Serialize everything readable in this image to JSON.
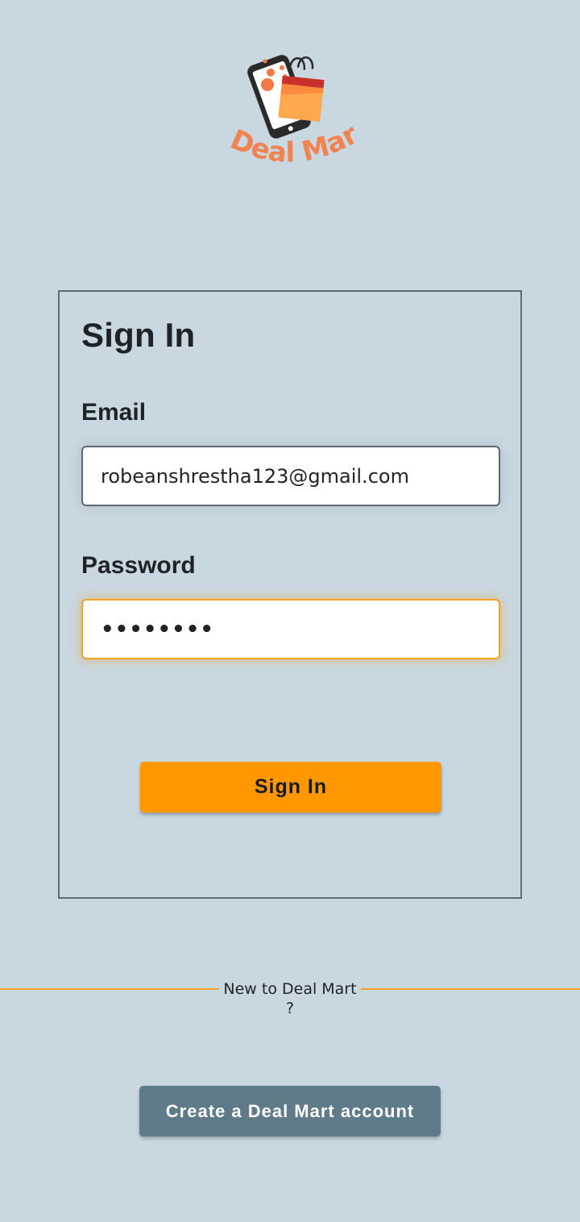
{
  "brand": {
    "name": "Deal Mart",
    "logo_icon": "phone-shopping-bag-icon",
    "logo_text_color": "#f28350",
    "bag_color": "#fb8a3c"
  },
  "signin": {
    "title": "Sign In",
    "email_label": "Email",
    "email_value": "robeanshrestha123@gmail.com",
    "password_label": "Password",
    "password_value": "••••••••",
    "submit_label": "Sign In"
  },
  "register": {
    "divider_text": "New to Deal Mart ?",
    "create_label": "Create a Deal Mart account"
  },
  "colors": {
    "background": "#c9d7e0",
    "accent": "#fe9700",
    "secondary_button": "#5f7a88",
    "focus_border": "#f3a221"
  }
}
